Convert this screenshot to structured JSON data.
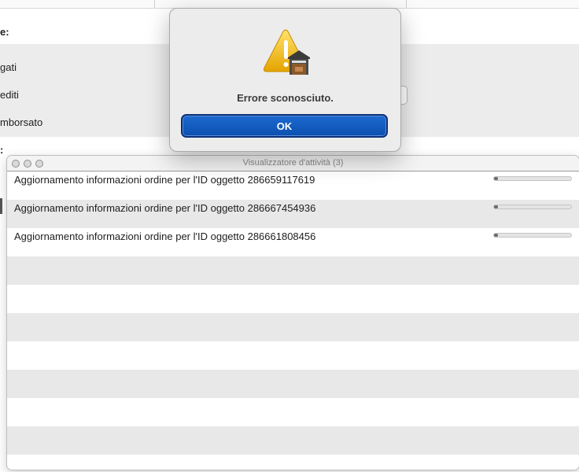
{
  "background_window": {
    "labels": [
      "e:",
      "gati",
      "editi",
      "mborsato",
      ":"
    ]
  },
  "alert": {
    "message": "Errore sconosciuto.",
    "ok_label": "OK",
    "icon": "warning-icon"
  },
  "activity_viewer": {
    "title": "Visualizzatore d'attività (3)",
    "rows": [
      {
        "text": "Aggiornamento informazioni ordine per l'ID oggetto 286659117619",
        "progress": 0.05
      },
      {
        "text": "Aggiornamento informazioni ordine per l'ID oggetto 286667454936",
        "progress": 0.05
      },
      {
        "text": "Aggiornamento informazioni ordine per l'ID oggetto 286661808456",
        "progress": 0.05
      }
    ],
    "empty_row_count": 8
  }
}
